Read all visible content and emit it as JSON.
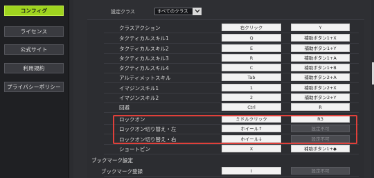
{
  "sidebar": {
    "items": [
      {
        "label": "コンフィグ",
        "active": true
      },
      {
        "label": "ライセンス",
        "active": false
      },
      {
        "label": "公式サイト",
        "active": false
      },
      {
        "label": "利用規約",
        "active": false
      },
      {
        "label": "プライバシーポリシー",
        "active": false
      }
    ]
  },
  "filter": {
    "label": "設定クラス",
    "value": "すべてのクラス"
  },
  "rows": [
    {
      "label": "クラスアクション",
      "key1": "右クリック",
      "key2": "Y"
    },
    {
      "label": "タクティカルスキル1",
      "key1": "Q",
      "key2": "補助ボタン1+X"
    },
    {
      "label": "タクティカルスキル2",
      "key1": "E",
      "key2": "補助ボタン1+Y"
    },
    {
      "label": "タクティカルスキル3",
      "key1": "R",
      "key2": "補助ボタン1+A"
    },
    {
      "label": "タクティカルスキル4",
      "key1": "C",
      "key2": "補助ボタン1+B"
    },
    {
      "label": "アルティメットスキル",
      "key1": "Tab",
      "key2": "補助ボタン2+A"
    },
    {
      "label": "イマジンスキル1",
      "key1": "1",
      "key2": "補助ボタン2+X"
    },
    {
      "label": "イマジンスキル2",
      "key1": "2",
      "key2": "補助ボタン2+Y"
    },
    {
      "label": "回避",
      "key1": "Ctrl",
      "key2": "R"
    },
    {
      "label": "ロックオン",
      "key1": "ミドルクリック",
      "key2": "R3"
    },
    {
      "label": "ロックオン切り替え・左",
      "key1": "ホイール↑",
      "key2": "設定不可"
    },
    {
      "label": "ロックオン切り替え・右",
      "key1": "ホイール↓",
      "key2": "設定不可"
    },
    {
      "label": "ショートピン",
      "key1": "X",
      "key2": "補助ボタン1+◆"
    }
  ],
  "bookmark": {
    "section_title": "ブックマーク設定",
    "row": {
      "label": "ブックマーク登録",
      "key1": "I",
      "key2": "設定不可"
    }
  },
  "colors": {
    "accent": "#9fd41f",
    "highlight": "#e0403a"
  }
}
